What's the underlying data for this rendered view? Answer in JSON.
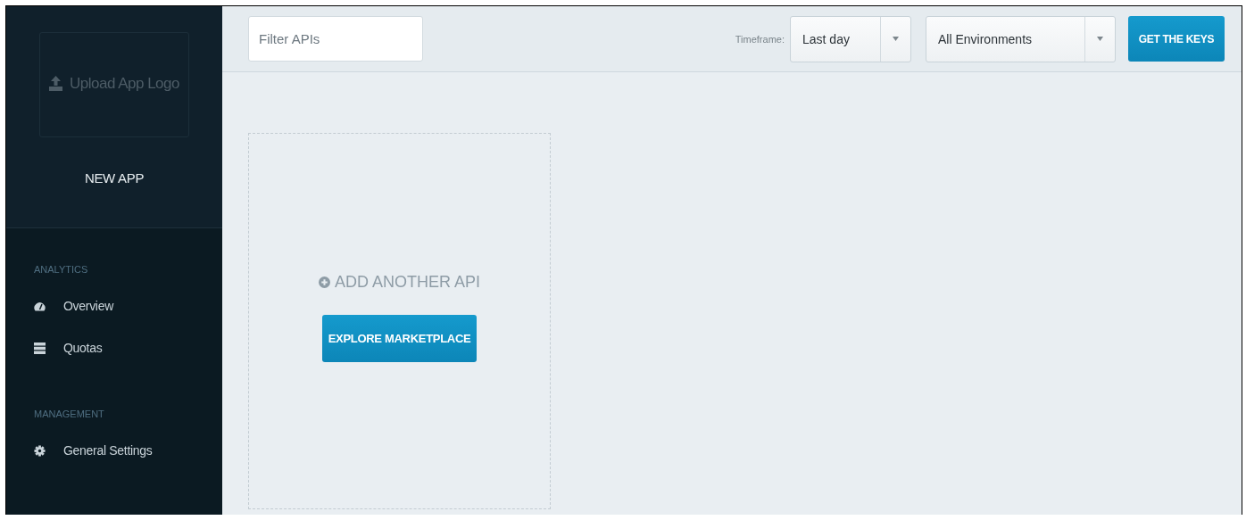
{
  "sidebar": {
    "logo_upload": {
      "label": "Upload App Logo"
    },
    "app_name": "NEW APP",
    "sections": [
      {
        "title": "ANALYTICS",
        "items": [
          {
            "label": "Overview",
            "kind": "gauge"
          },
          {
            "label": "Quotas",
            "kind": "stack"
          }
        ]
      },
      {
        "title": "MANAGEMENT",
        "items": [
          {
            "label": "General Settings",
            "kind": "gear"
          }
        ]
      }
    ]
  },
  "toolbar": {
    "filter": {
      "placeholder": "Filter APIs"
    },
    "timeframe_label": "Timeframe:",
    "timeframe": {
      "value": "Last day"
    },
    "environment": {
      "value": "All Environments"
    },
    "keys_button": "GET THE KEYS"
  },
  "add_card": {
    "label": "ADD ANOTHER API",
    "button": "EXPLORE MARKETPLACE"
  }
}
